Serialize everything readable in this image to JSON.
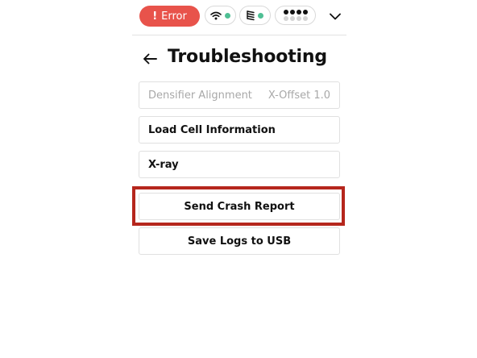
{
  "status_bar": {
    "error_label": "Error",
    "error_icon": "!",
    "wifi": {
      "icon": "wifi-icon",
      "status_color": "#4fbf94"
    },
    "scale": {
      "icon": "stack-icon",
      "status_color": "#4fbf94"
    },
    "signal": {
      "icon": "dots-icon",
      "filled": 4,
      "total": 8
    },
    "menu_icon": "chevron-down-icon",
    "error_color": "#e8534b"
  },
  "header": {
    "back_icon": "arrow-left-icon",
    "title": "Troubleshooting"
  },
  "items": [
    {
      "label": "Densifier Alignment",
      "value": "X-Offset 1.0",
      "state": "disabled"
    },
    {
      "label": "Load Cell Information"
    },
    {
      "label": "X-ray"
    },
    {
      "label": "Send Crash Report",
      "highlighted": true
    },
    {
      "label": "Save Logs to USB"
    }
  ],
  "highlight_color": "#b5261c"
}
